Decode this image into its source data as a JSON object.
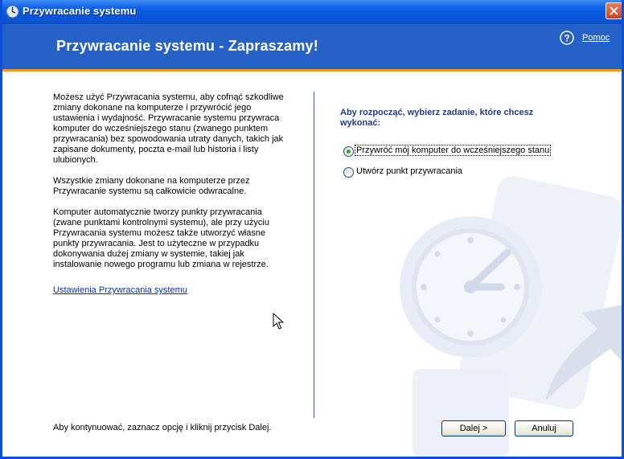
{
  "window": {
    "title": "Przywracanie systemu",
    "colors": {
      "titlebar": "#0b5fe8",
      "banner": "#2661c8",
      "accent": "#f39b21"
    }
  },
  "header": {
    "heading": "Przywracanie systemu - Zapraszamy!",
    "help_icon": "help-icon",
    "help_label": "Pomoc"
  },
  "left_panel": {
    "paragraph1": "Możesz użyć Przywracania systemu, aby cofnąć szkodliwe zmiany dokonane na komputerze i przywrócić jego ustawienia i wydajność. Przywracanie systemu przywraca komputer do wcześniejszego stanu (zwanego punktem przywracania) bez spowodowania utraty danych, takich jak zapisane dokumenty, poczta e-mail lub historia i listy ulubionych.",
    "paragraph2": "Wszystkie zmiany dokonane na komputerze przez Przywracanie systemu są całkowicie odwracalne.",
    "paragraph3": "Komputer automatycznie tworzy punkty przywracania (zwane punktami kontrolnymi systemu), ale przy użyciu Przywracania systemu możesz także utworzyć własne punkty przywracania. Jest to użyteczne w przypadku dokonywania dużej zmiany w systemie, takiej jak instalowanie nowego programu lub zmiana w rejestrze.",
    "settings_link": "Ustawienia Przywracania systemu"
  },
  "right_panel": {
    "prompt": "Aby rozpocząć, wybierz zadanie, które chcesz wykonać:",
    "options": [
      {
        "label": "Przywróć mój komputer do wcześniejszego stanu",
        "selected": true
      },
      {
        "label": "Utwórz punkt przywracania",
        "selected": false
      }
    ]
  },
  "footer": {
    "instruction": "Aby kontynuować, zaznacz opcję i kliknij przycisk Dalej.",
    "next_label": "Dalej >",
    "cancel_label": "Anuluj"
  }
}
